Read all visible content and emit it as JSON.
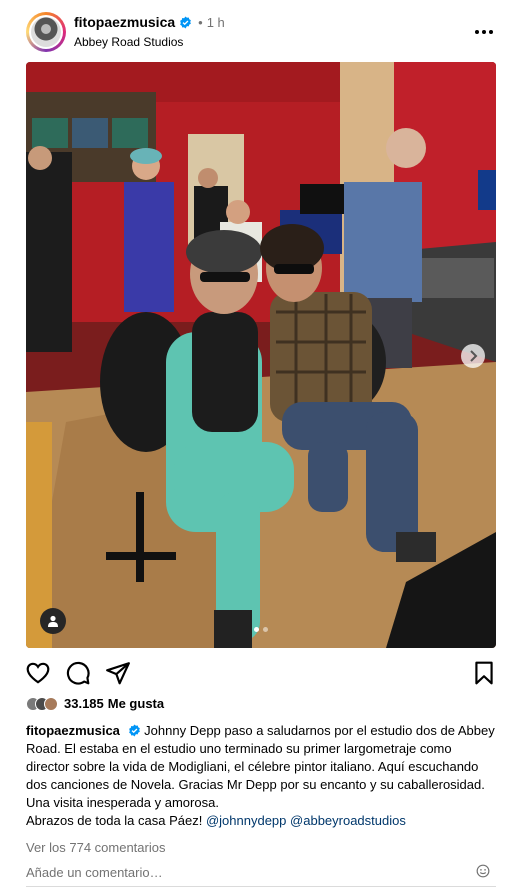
{
  "post": {
    "username": "fitopaezmusica",
    "time": "1 h",
    "location": "Abbey Road Studios",
    "photo": {
      "carousel_count": 2,
      "carousel_active": 1,
      "icons": {
        "next": "chevron-right-icon",
        "user_tag": "person-icon"
      }
    },
    "actions": {
      "icons": [
        "heart-icon",
        "comment-bubble-icon",
        "share-paper-plane-icon",
        "bookmark-icon"
      ]
    },
    "likes_count": "33.185",
    "likes_label": "Me gusta",
    "caption": {
      "text": "Johnny Depp paso a saludarnos por el estudio dos de Abbey Road. El estaba en el estudio uno terminado su primer largometraje como director sobre la vida de Modigliani, el célebre pintor italiano. Aquí escuchando dos canciones de Novela. Gracias Mr Depp por su encanto y su caballerosidad. Una visita inesperada y amorosa.",
      "signoff": "Abrazos de toda la casa Páez!",
      "mention_1": "@johnnydepp",
      "mention_2": "@abbeyroadstudios"
    },
    "comments_link": "Ver los 774 comentarios",
    "comment_placeholder": "Añade un comentario…"
  },
  "colors": {
    "verified": "#0095f6",
    "mention": "#00376b",
    "muted_text": "#737373",
    "studio_red": "#c0202a"
  }
}
